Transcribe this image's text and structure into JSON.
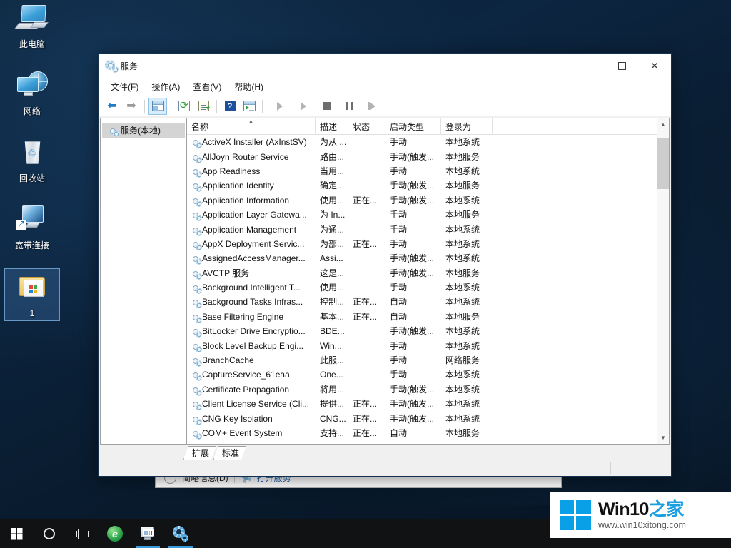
{
  "desktop": {
    "icons": [
      {
        "name": "this-pc",
        "label": "此电脑",
        "selected": false
      },
      {
        "name": "network",
        "label": "网络",
        "selected": false
      },
      {
        "name": "recycle-bin",
        "label": "回收站",
        "selected": false
      },
      {
        "name": "broadband",
        "label": "宽带连接",
        "selected": false
      },
      {
        "name": "folder-1",
        "label": "1",
        "selected": true
      }
    ]
  },
  "background_window": {
    "less_details_label": "简略信息(D)",
    "open_services_label": "打开服务"
  },
  "services_window": {
    "title": "服务",
    "window_buttons": {
      "minimize": "—",
      "maximize": "□",
      "close": "✕"
    },
    "menu": [
      {
        "label": "文件(F)"
      },
      {
        "label": "操作(A)"
      },
      {
        "label": "查看(V)"
      },
      {
        "label": "帮助(H)"
      }
    ],
    "toolbar": [
      {
        "name": "back",
        "title": "后退",
        "enabled": true,
        "active": false
      },
      {
        "name": "forward",
        "title": "前进",
        "enabled": true,
        "active": false
      },
      {
        "name": "show-hide-tree",
        "title": "显示/隐藏控制台树",
        "enabled": true,
        "active": true
      },
      {
        "name": "refresh",
        "title": "刷新",
        "enabled": true,
        "active": false
      },
      {
        "name": "export-list",
        "title": "导出列表",
        "enabled": true,
        "active": false
      },
      {
        "name": "help",
        "title": "帮助",
        "enabled": true,
        "active": false
      },
      {
        "name": "show-action-pane",
        "title": "显示操作窗格",
        "enabled": true,
        "active": false
      },
      {
        "name": "start-service",
        "title": "启动服务",
        "enabled": false,
        "active": false
      },
      {
        "name": "resume-service",
        "title": "恢复服务",
        "enabled": false,
        "active": false
      },
      {
        "name": "stop-service",
        "title": "停止服务",
        "enabled": false,
        "active": false
      },
      {
        "name": "pause-service",
        "title": "暂停服务",
        "enabled": false,
        "active": false
      },
      {
        "name": "restart-service",
        "title": "重启服务",
        "enabled": false,
        "active": false
      }
    ],
    "tree": {
      "items": [
        {
          "label": "服务(本地)",
          "selected": true
        }
      ]
    },
    "list": {
      "sort_column": "名称",
      "sort_direction": "ascending",
      "columns": [
        {
          "key": "name",
          "label": "名称"
        },
        {
          "key": "desc",
          "label": "描述"
        },
        {
          "key": "state",
          "label": "状态"
        },
        {
          "key": "start",
          "label": "启动类型"
        },
        {
          "key": "logon",
          "label": "登录为"
        }
      ],
      "rows": [
        {
          "name": "ActiveX Installer (AxInstSV)",
          "desc": "为从 ...",
          "state": "",
          "start": "手动",
          "logon": "本地系统"
        },
        {
          "name": "AllJoyn Router Service",
          "desc": "路由...",
          "state": "",
          "start": "手动(触发...",
          "logon": "本地服务"
        },
        {
          "name": "App Readiness",
          "desc": "当用...",
          "state": "",
          "start": "手动",
          "logon": "本地系统"
        },
        {
          "name": "Application Identity",
          "desc": "确定...",
          "state": "",
          "start": "手动(触发...",
          "logon": "本地服务"
        },
        {
          "name": "Application Information",
          "desc": "使用...",
          "state": "正在...",
          "start": "手动(触发...",
          "logon": "本地系统"
        },
        {
          "name": "Application Layer Gatewa...",
          "desc": "为 In...",
          "state": "",
          "start": "手动",
          "logon": "本地服务"
        },
        {
          "name": "Application Management",
          "desc": "为通...",
          "state": "",
          "start": "手动",
          "logon": "本地系统"
        },
        {
          "name": "AppX Deployment Servic...",
          "desc": "为部...",
          "state": "正在...",
          "start": "手动",
          "logon": "本地系统"
        },
        {
          "name": "AssignedAccessManager...",
          "desc": "Assi...",
          "state": "",
          "start": "手动(触发...",
          "logon": "本地系统"
        },
        {
          "name": "AVCTP 服务",
          "desc": "这是...",
          "state": "",
          "start": "手动(触发...",
          "logon": "本地服务"
        },
        {
          "name": "Background Intelligent T...",
          "desc": "使用...",
          "state": "",
          "start": "手动",
          "logon": "本地系统"
        },
        {
          "name": "Background Tasks Infras...",
          "desc": "控制...",
          "state": "正在...",
          "start": "自动",
          "logon": "本地系统"
        },
        {
          "name": "Base Filtering Engine",
          "desc": "基本...",
          "state": "正在...",
          "start": "自动",
          "logon": "本地服务"
        },
        {
          "name": "BitLocker Drive Encryptio...",
          "desc": "BDE...",
          "state": "",
          "start": "手动(触发...",
          "logon": "本地系统"
        },
        {
          "name": "Block Level Backup Engi...",
          "desc": "Win...",
          "state": "",
          "start": "手动",
          "logon": "本地系统"
        },
        {
          "name": "BranchCache",
          "desc": "此服...",
          "state": "",
          "start": "手动",
          "logon": "网络服务"
        },
        {
          "name": "CaptureService_61eaa",
          "desc": "One...",
          "state": "",
          "start": "手动",
          "logon": "本地系统"
        },
        {
          "name": "Certificate Propagation",
          "desc": "将用...",
          "state": "",
          "start": "手动(触发...",
          "logon": "本地系统"
        },
        {
          "name": "Client License Service (Cli...",
          "desc": "提供...",
          "state": "正在...",
          "start": "手动(触发...",
          "logon": "本地系统"
        },
        {
          "name": "CNG Key Isolation",
          "desc": "CNG...",
          "state": "正在...",
          "start": "手动(触发...",
          "logon": "本地系统"
        },
        {
          "name": "COM+ Event System",
          "desc": "支持...",
          "state": "正在...",
          "start": "自动",
          "logon": "本地服务"
        }
      ]
    },
    "tabs": [
      {
        "label": "扩展",
        "active": false
      },
      {
        "label": "标准",
        "active": true
      }
    ],
    "statusbar": {
      "text": ""
    }
  },
  "taskbar": {
    "items": [
      {
        "name": "start-button",
        "label": "开始",
        "running": false
      },
      {
        "name": "cortana-search",
        "label": "搜索",
        "running": false
      },
      {
        "name": "task-view",
        "label": "任务视图",
        "running": false
      },
      {
        "name": "browser",
        "label": "浏览器",
        "running": false
      },
      {
        "name": "task-manager",
        "label": "任务管理器",
        "running": true
      },
      {
        "name": "services",
        "label": "服务",
        "running": true
      }
    ],
    "tray": {
      "chevron": "^"
    }
  },
  "watermark": {
    "title_en": "Win10",
    "title_zh": "之家",
    "url": "www.win10xitong.com"
  }
}
